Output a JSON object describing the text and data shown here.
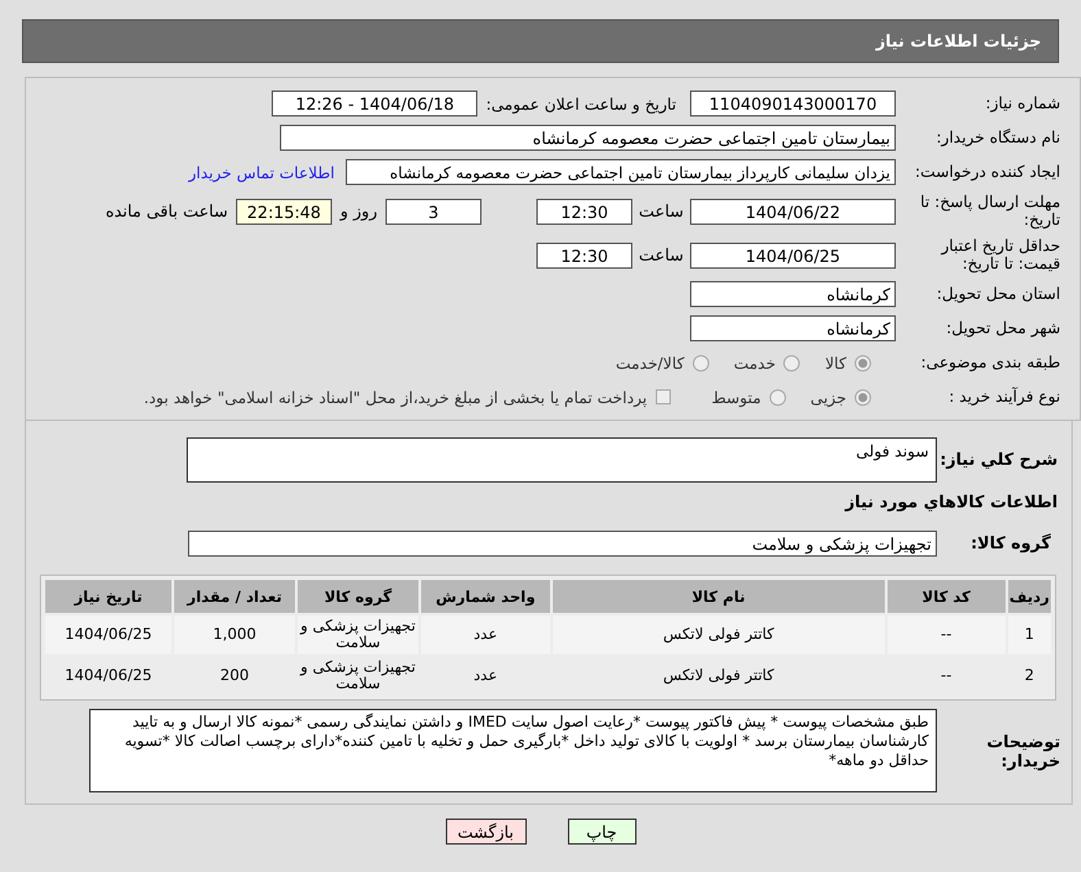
{
  "header": {
    "title": "جزئیات اطلاعات نیاز"
  },
  "need_number": {
    "label": "شماره نیاز:",
    "value": "1104090143000170"
  },
  "announce": {
    "label": "تاریخ و ساعت اعلان عمومی:",
    "value": "1404/06/18 - 12:26"
  },
  "buyer_org": {
    "label": "نام دستگاه خریدار:",
    "value": "بیمارستان تامین اجتماعی حضرت معصومه کرمانشاه"
  },
  "requester": {
    "label": "ایجاد کننده درخواست:",
    "value": "یزدان  سلیمانی کارپرداز بیمارستان تامین اجتماعی حضرت معصومه کرمانشاه",
    "link": "اطلاعات تماس خریدار"
  },
  "reply_deadline": {
    "label": "مهلت ارسال پاسخ: تا تاریخ:",
    "date": "1404/06/22",
    "time_label": "ساعت",
    "time": "12:30",
    "days": "3",
    "days_label": "روز و",
    "remaining": "22:15:48",
    "remaining_label": "ساعت باقی مانده"
  },
  "validity_deadline": {
    "label": "حداقل تاریخ اعتبار قیمت: تا تاریخ:",
    "date": "1404/06/25",
    "time_label": "ساعت",
    "time": "12:30"
  },
  "province": {
    "label": "استان محل تحویل:",
    "value": "کرمانشاه"
  },
  "city": {
    "label": "شهر محل تحویل:",
    "value": "کرمانشاه"
  },
  "category": {
    "label": "طبقه بندی موضوعی:",
    "options": [
      {
        "label": "کالا",
        "selected": true
      },
      {
        "label": "خدمت",
        "selected": false
      },
      {
        "label": "کالا/خدمت",
        "selected": false
      }
    ]
  },
  "process": {
    "label": "نوع فرآیند خرید :",
    "options": [
      {
        "label": "جزیی",
        "selected": true
      },
      {
        "label": "متوسط",
        "selected": false
      }
    ],
    "payment": {
      "checked": false,
      "label": "پرداخت تمام یا بخشی از مبلغ خرید،از محل \"اسناد خزانه اسلامی\" خواهد بود."
    }
  },
  "description": {
    "label": "شرح کلي نیاز:",
    "value": "سوند فولی"
  },
  "goods_title": "اطلاعات کالاهاي مورد نياز",
  "goods_group": {
    "label": "گروه کالا:",
    "value": "تجهیزات پزشکی و سلامت"
  },
  "table": {
    "columns": [
      "ردیف",
      "کد کالا",
      "نام کالا",
      "واحد شمارش",
      "گروه کالا",
      "تعداد / مقدار",
      "تاریخ نیاز"
    ],
    "rows": [
      [
        "1",
        "--",
        "کاتتر فولی لاتکس",
        "عدد",
        "تجهیزات پزشکی و سلامت",
        "1,000",
        "1404/06/25"
      ],
      [
        "2",
        "--",
        "کاتتر فولی لاتکس",
        "عدد",
        "تجهیزات پزشکی و سلامت",
        "200",
        "1404/06/25"
      ]
    ]
  },
  "notes": {
    "label": "توضیحات خریدار:",
    "value": "طبق مشخصات پیوست * پیش فاکتور پیوست *رعایت اصول سایت IMED و داشتن نمایندگی رسمی *نمونه کالا ارسال و به تایید کارشناسان بیمارستان برسد * اولویت با کالای تولید داخل  *بارگیری حمل و تخلیه با تامین کننده*دارای برچسب اصالت کالا *تسویه حداقل دو ماهه*"
  },
  "buttons": [
    {
      "kind": "print",
      "label": "چاپ"
    },
    {
      "kind": "back",
      "label": "بازگشت"
    }
  ]
}
